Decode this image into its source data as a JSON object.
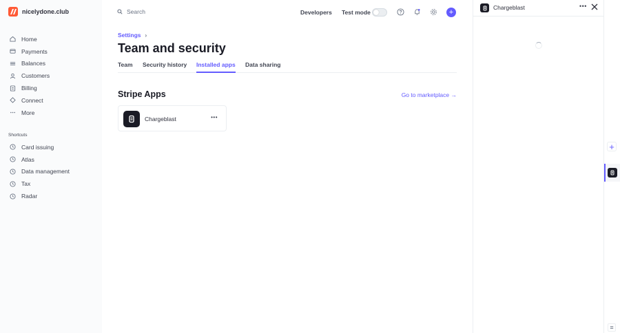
{
  "brand": {
    "name": "nicelydone.club"
  },
  "sidebar": {
    "items": [
      {
        "label": "Home",
        "icon": "home-icon"
      },
      {
        "label": "Payments",
        "icon": "payments-icon"
      },
      {
        "label": "Balances",
        "icon": "balances-icon"
      },
      {
        "label": "Customers",
        "icon": "customers-icon"
      },
      {
        "label": "Billing",
        "icon": "billing-icon"
      },
      {
        "label": "Connect",
        "icon": "connect-icon"
      },
      {
        "label": "More",
        "icon": "more-icon"
      }
    ],
    "shortcuts_title": "Shortcuts",
    "shortcuts": [
      {
        "label": "Card issuing",
        "icon": "clock-icon"
      },
      {
        "label": "Atlas",
        "icon": "clock-icon"
      },
      {
        "label": "Data management",
        "icon": "clock-icon"
      },
      {
        "label": "Tax",
        "icon": "clock-icon"
      },
      {
        "label": "Radar",
        "icon": "clock-icon"
      }
    ]
  },
  "topbar": {
    "search_placeholder": "Search",
    "developers": "Developers",
    "test_mode": "Test mode"
  },
  "main": {
    "breadcrumb": "Settings",
    "title": "Team and security",
    "tabs": [
      {
        "label": "Team"
      },
      {
        "label": "Security history"
      },
      {
        "label": "Installed apps"
      },
      {
        "label": "Data sharing"
      }
    ],
    "section_title": "Stripe Apps",
    "marketplace_link": "Go to marketplace →",
    "app": {
      "name": "Chargeblast"
    }
  },
  "drawer": {
    "title": "Chargeblast"
  },
  "colors": {
    "accent": "#635bff",
    "text": "#30313d"
  }
}
